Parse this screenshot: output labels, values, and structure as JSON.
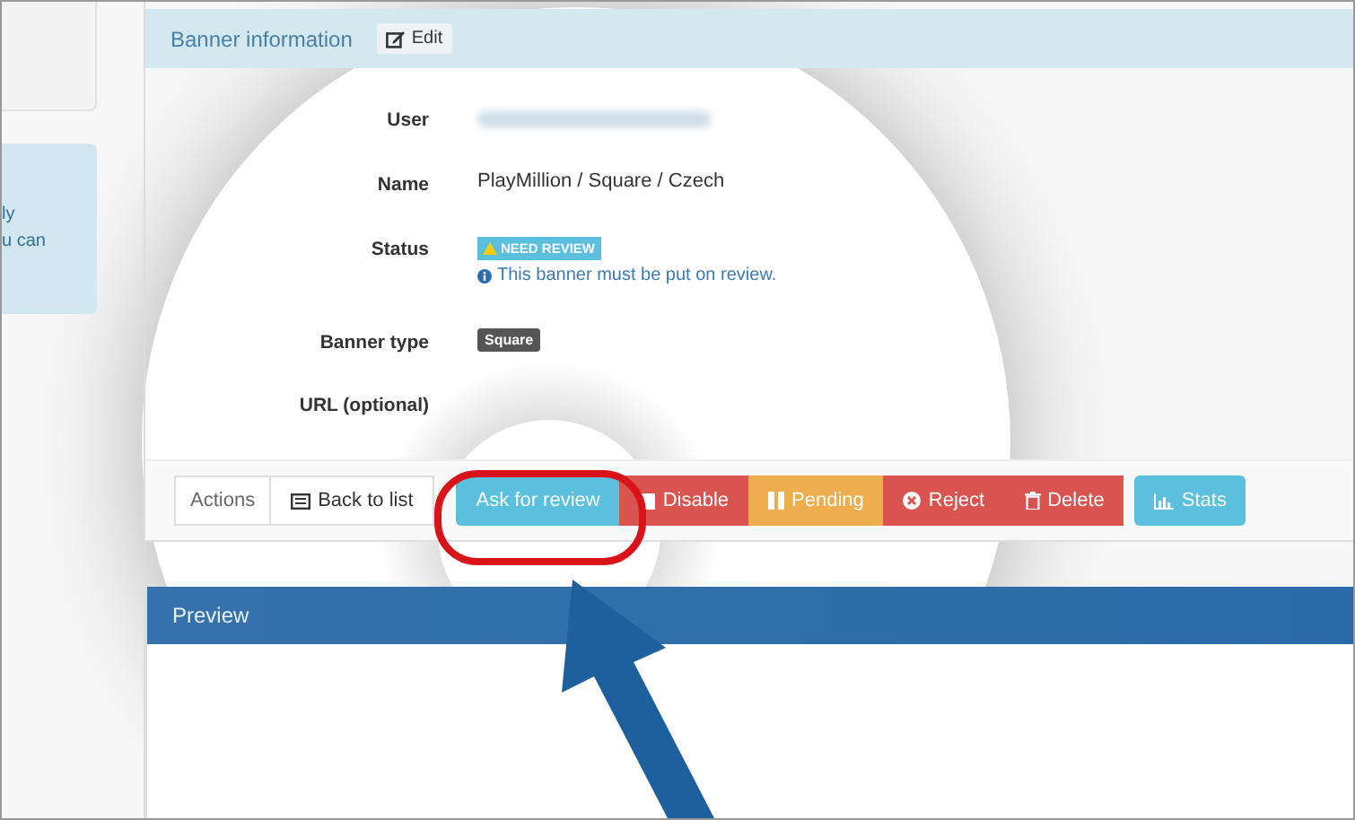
{
  "sidebar": {
    "fragments": [
      "ly",
      "u can"
    ]
  },
  "panel": {
    "title": "Banner information",
    "edit_button": "Edit"
  },
  "fields": [
    {
      "label": "User",
      "kind": "blurred"
    },
    {
      "label": "Name",
      "kind": "text",
      "value": "PlayMillion / Square / Czech"
    },
    {
      "label": "Status",
      "kind": "status",
      "value": "NEED REVIEW",
      "note": "This banner must be put on review."
    },
    {
      "label": "Banner type",
      "kind": "tag",
      "value": "Square"
    },
    {
      "label": "URL (optional)",
      "kind": "empty"
    }
  ],
  "actions": {
    "label": "Actions",
    "buttons": [
      {
        "label": "Back to list",
        "kind": "back",
        "color": "#ffffff"
      },
      {
        "label": "Ask for review",
        "kind": "review",
        "color": "#5bc0de"
      },
      {
        "label": "Disable",
        "kind": "disable",
        "color": "#d9534f"
      },
      {
        "label": "Pending",
        "kind": "pending",
        "color": "#f0ad4e"
      },
      {
        "label": "Reject",
        "kind": "reject",
        "color": "#d9534f"
      },
      {
        "label": "Delete",
        "kind": "delete",
        "color": "#d9534f"
      },
      {
        "label": "Stats",
        "kind": "stats",
        "color": "#5bc0de"
      }
    ]
  },
  "preview": {
    "title": "Preview"
  }
}
